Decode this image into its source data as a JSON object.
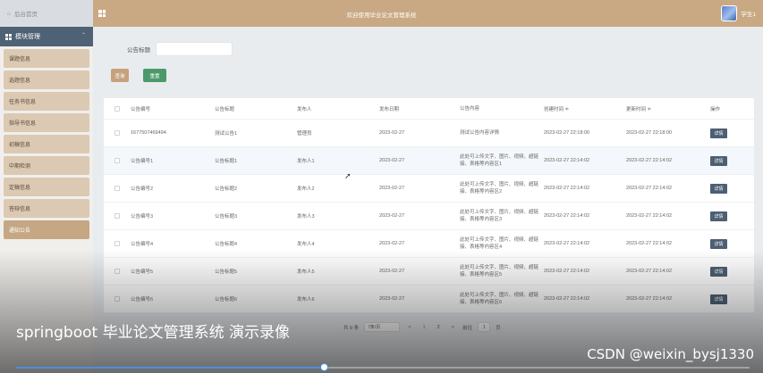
{
  "topbar": {
    "home_label": "后台首页",
    "title": "欢迎使用毕业论文管理系统",
    "user_name": "学生1"
  },
  "sidebar": {
    "section_label": "模块管理",
    "items": [
      {
        "label": "课题信息",
        "active": false
      },
      {
        "label": "选题信息",
        "active": false
      },
      {
        "label": "任务书信息",
        "active": false
      },
      {
        "label": "指导书信息",
        "active": false
      },
      {
        "label": "初稿信息",
        "active": false
      },
      {
        "label": "中期检测",
        "active": false
      },
      {
        "label": "定稿信息",
        "active": false
      },
      {
        "label": "答辩信息",
        "active": false
      },
      {
        "label": "通知公告",
        "active": true
      }
    ]
  },
  "search": {
    "label": "公告标题",
    "value": "",
    "placeholder": ""
  },
  "buttons": {
    "query": "查询",
    "reset": "重置"
  },
  "table": {
    "columns": [
      "公告编号",
      "公告标题",
      "发布人",
      "发布日期",
      "公告内容",
      "创建时间 ≑",
      "更新时间 ≑",
      "操作"
    ],
    "detail_label": "详情",
    "rows": [
      {
        "no": "1677507469494",
        "title": "测试公告1",
        "publisher": "管理员",
        "date": "2023-02-27",
        "content": "测试公告内容详情",
        "created": "2023-02-27 22:18:00",
        "updated": "2023-02-27 22:18:00"
      },
      {
        "no": "公告编号1",
        "title": "公告标题1",
        "publisher": "发布人1",
        "date": "2023-02-27",
        "content": "此处可上传文字、图片、视频、超链接、表格等内容区1",
        "created": "2023-02-27 22:14:02",
        "updated": "2023-02-27 22:14:02"
      },
      {
        "no": "公告编号2",
        "title": "公告标题2",
        "publisher": "发布人2",
        "date": "2023-02-27",
        "content": "此处可上传文字、图片、视频、超链接、表格等内容区2",
        "created": "2023-02-27 22:14:02",
        "updated": "2023-02-27 22:14:02"
      },
      {
        "no": "公告编号3",
        "title": "公告标题3",
        "publisher": "发布人3",
        "date": "2023-02-27",
        "content": "此处可上传文字、图片、视频、超链接、表格等内容区3",
        "created": "2023-02-27 22:14:02",
        "updated": "2023-02-27 22:14:02"
      },
      {
        "no": "公告编号4",
        "title": "公告标题4",
        "publisher": "发布人4",
        "date": "2023-02-27",
        "content": "此处可上传文字、图片、视频、超链接、表格等内容区4",
        "created": "2023-02-27 22:14:02",
        "updated": "2023-02-27 22:14:02"
      },
      {
        "no": "公告编号5",
        "title": "公告标题5",
        "publisher": "发布人5",
        "date": "2023-02-27",
        "content": "此处可上传文字、图片、视频、超链接、表格等内容区5",
        "created": "2023-02-27 22:14:02",
        "updated": "2023-02-27 22:14:02"
      },
      {
        "no": "公告编号6",
        "title": "公告标题6",
        "publisher": "发布人6",
        "date": "2023-02-27",
        "content": "此处可上传文字、图片、视频、超链接、表格等内容区6",
        "created": "2023-02-27 22:14:02",
        "updated": "2023-02-27 22:14:02"
      }
    ]
  },
  "pager": {
    "total": "共 9 条",
    "page_size": "7条/页",
    "prev": "<",
    "pages": [
      "1",
      "2"
    ],
    "current_page": "1",
    "next": ">",
    "goto_prefix": "前往",
    "goto_value": "1",
    "goto_suffix": "页"
  },
  "video": {
    "caption": "springboot 毕业论文管理系统 演示录像",
    "watermark": "CSDN @weixin_bysj1330",
    "progress": 0.42
  }
}
